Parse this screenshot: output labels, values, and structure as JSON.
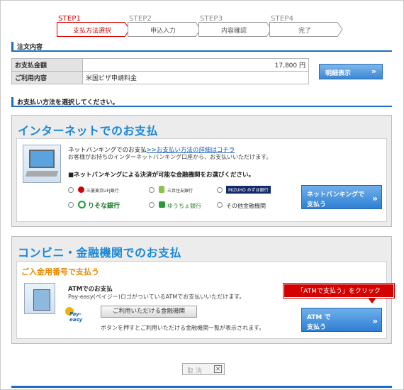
{
  "steps": [
    {
      "num": "STEP1",
      "label": "支払方法選択",
      "active": true
    },
    {
      "num": "STEP2",
      "label": "申込入力",
      "active": false
    },
    {
      "num": "STEP3",
      "label": "内容確認",
      "active": false
    },
    {
      "num": "STEP4",
      "label": "完了",
      "active": false
    }
  ],
  "order": {
    "heading": "注文内容",
    "rows": [
      {
        "label": "お支払金額",
        "value": "17,800 円"
      },
      {
        "label": "ご利用内容",
        "value": "米国ビザ申請料金"
      }
    ],
    "detail_button": "明細表示",
    "detail_arrow": "»"
  },
  "select_heading": "お支払い方法を選択してください。",
  "net": {
    "title": "インターネットでのお支払",
    "line1_prefix": "ネットバンキングでのお支払",
    "line1_link": ">>お支払い方法の詳細はコチラ",
    "line2": "お客様がお持ちのインターネットバンキング口座から、お支払いいただけます。",
    "line3": "■ネットバンキングによる決済が可能な金融機関をお選びください。",
    "banks": {
      "b1": "三菱東京UFJ銀行",
      "b2": "三井住友銀行",
      "b3": "MIZUHO みずほ銀行",
      "b4": "りそな銀行",
      "b5": "ゆうちょ銀行",
      "b6": "その他金融機関"
    },
    "button_l1": "ネットバンキングで",
    "button_l2": "支払う",
    "button_arrow": "»"
  },
  "conv": {
    "title": "コンビニ・金融機関でのお支払",
    "subtitle": "ご入金用番号で支払う",
    "atm_title": "ATMでのお支払",
    "atm_desc": "Pay-easy(ペイジー)ロゴがついているATMでお支払いいただけます。",
    "payeasy_logo": "Pay-easy",
    "inst_button": "ご利用いただける金融機関",
    "inst_desc": "ボタンを押すとご利用いただける金融機関一覧が表示されます。",
    "button_l1": "ATM で",
    "button_l2": "支払う",
    "button_arrow": "»"
  },
  "callout": "「ATMで支払う」をクリック",
  "cancel": {
    "label": "取 消",
    "icon": "✕"
  },
  "colors": {
    "accent": "#1a6fc4",
    "title_blue": "#1a88d8",
    "orange": "#e88a00",
    "red": "#d40000"
  }
}
